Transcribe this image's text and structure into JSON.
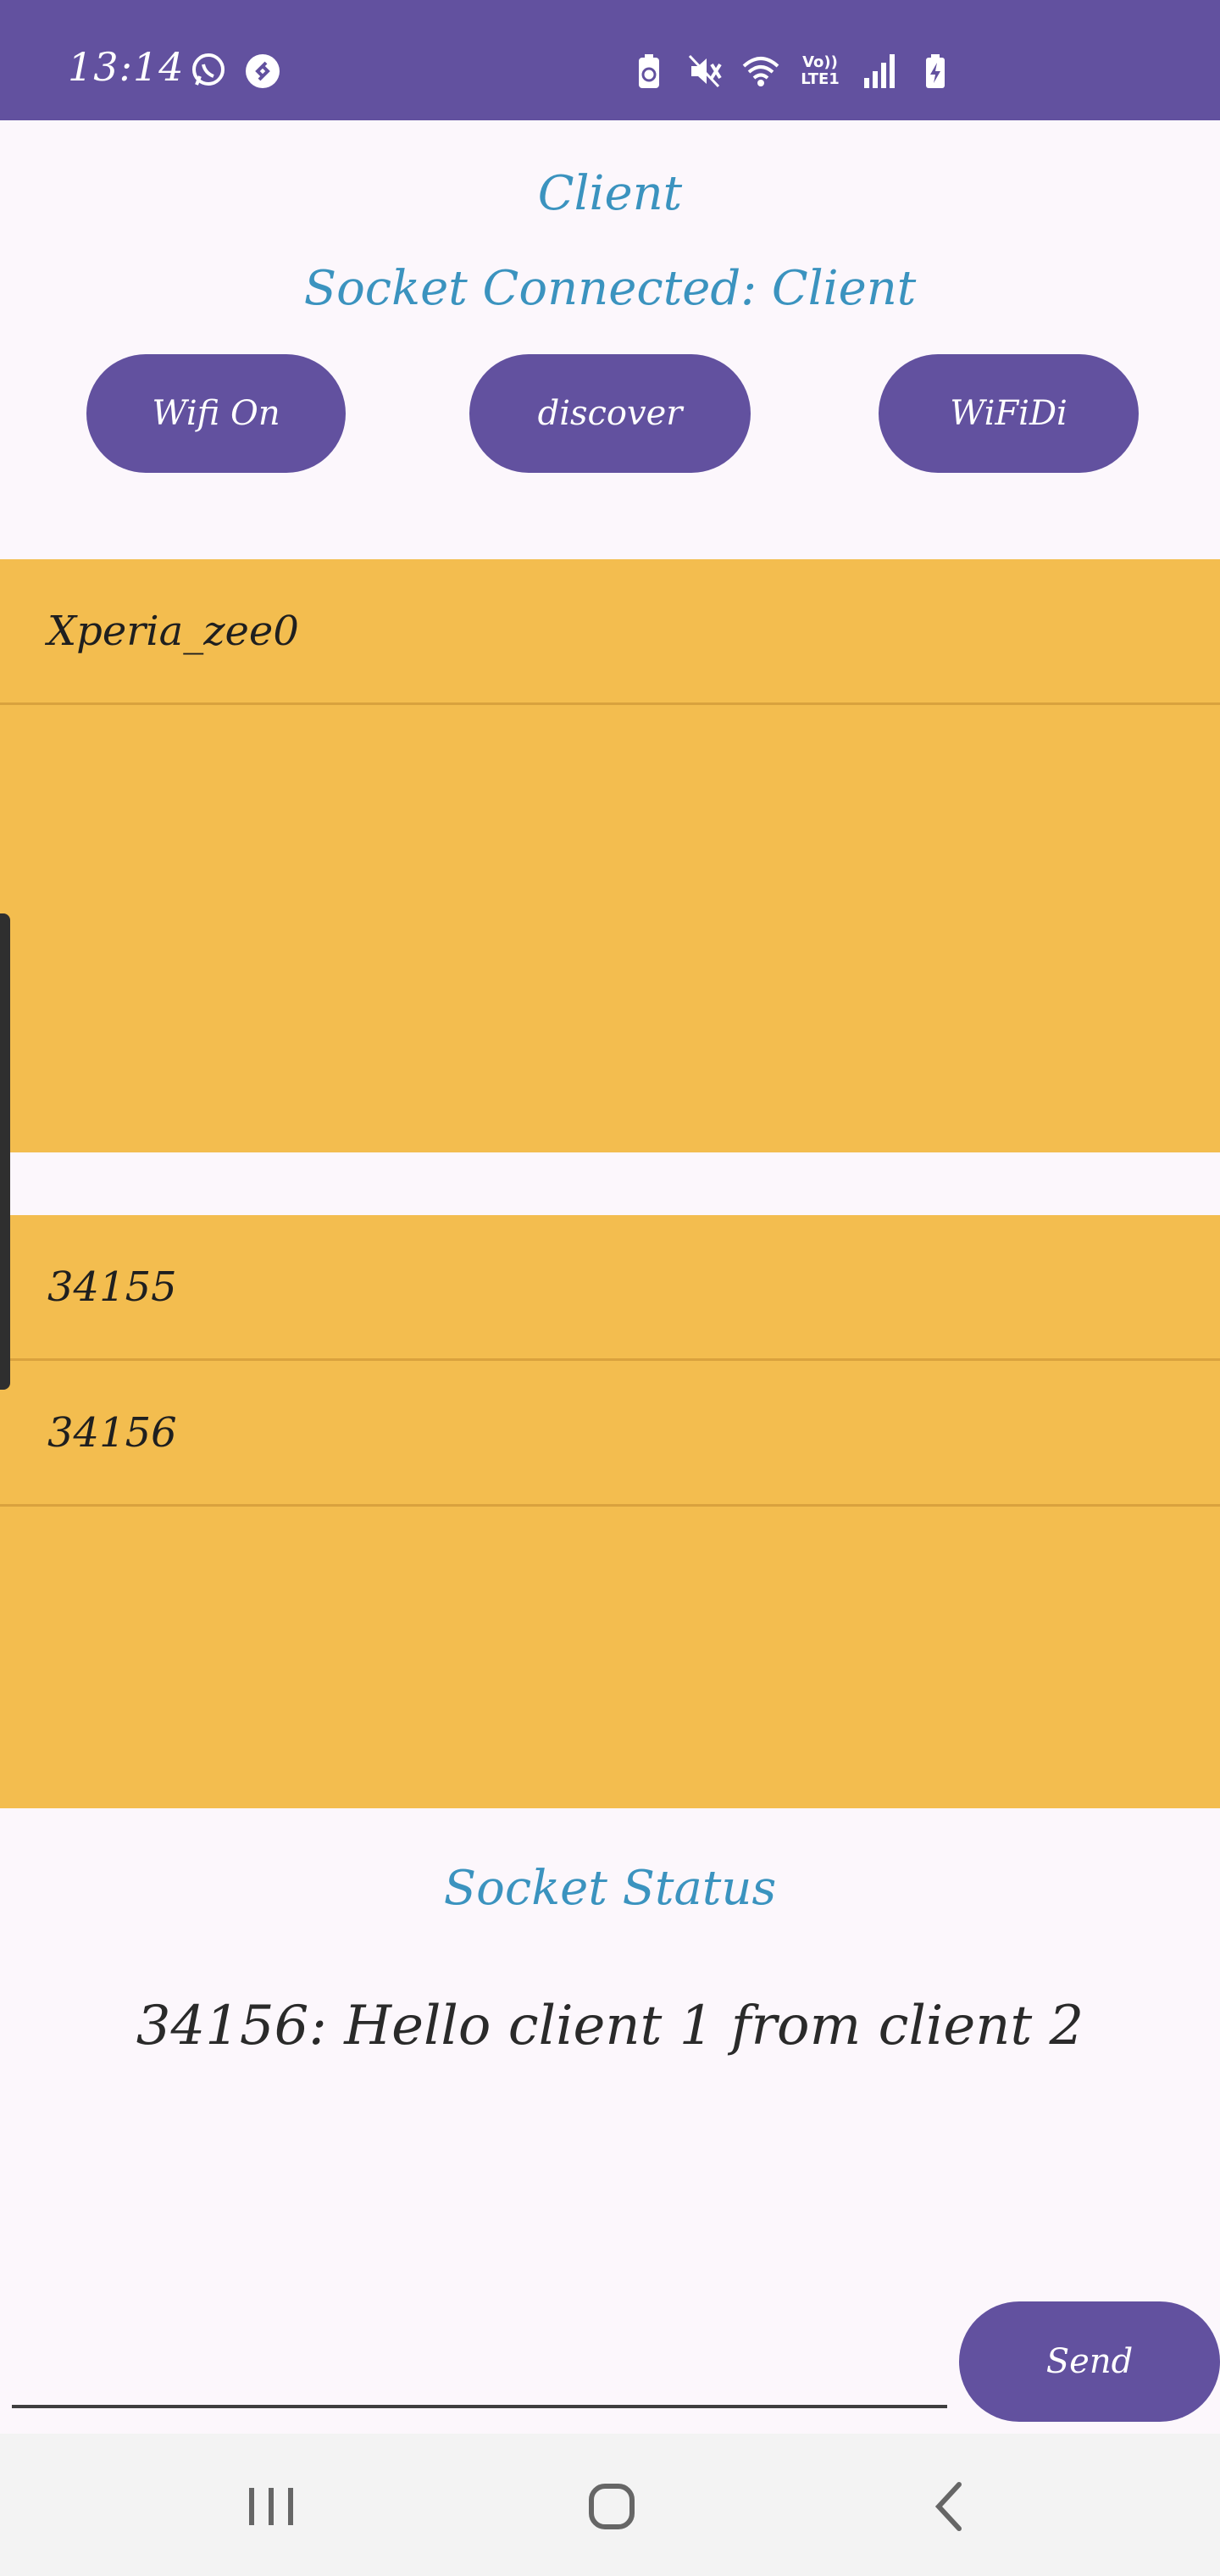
{
  "status_bar": {
    "time": "13:14",
    "left_icons": [
      "whatsapp-icon",
      "shazam-icon"
    ],
    "right_icons": [
      "battery-saver-icon",
      "mute-icon",
      "wifi-icon",
      "volte-icon",
      "signal-icon",
      "battery-charging-icon"
    ],
    "volte_label": "Vo))",
    "lte_label": "LTE1"
  },
  "header": {
    "app_title": "Client",
    "connection_status": "Socket Connected: Client"
  },
  "toolbar": {
    "wifi_on_label": "Wifi On",
    "discover_label": "discover",
    "wifidi_label": "WiFiDi"
  },
  "peer_list": {
    "items": [
      "Xperia_zee0"
    ]
  },
  "message_list": {
    "items": [
      "34155",
      "34156"
    ]
  },
  "socket_status": {
    "label": "Socket Status",
    "message": "34156: Hello client 1 from client 2"
  },
  "composer": {
    "input_value": "",
    "send_label": "Send"
  },
  "colors": {
    "primary": "#62519f",
    "accent_text": "#3b93bf",
    "list_bg": "#f3bd4f",
    "page_bg": "#fcf7fc"
  }
}
